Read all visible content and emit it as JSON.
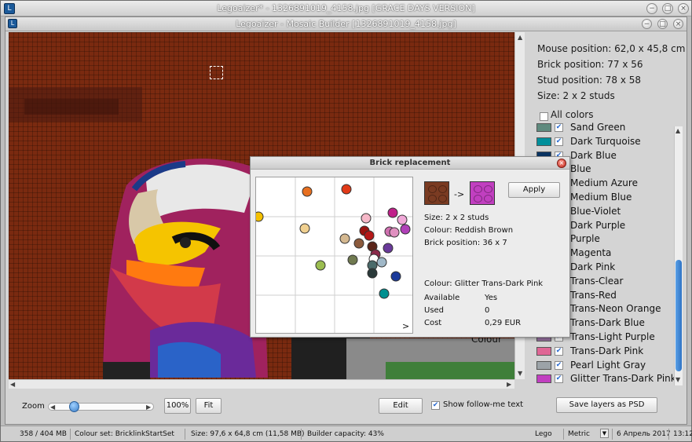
{
  "window": {
    "title": "Legoaizer* - 1326891019_4158.jpg       [GRACE DAYS VERSION]",
    "inner_title": "Legoaizer - Mosaic Builder [1326891019_4158.jpg]"
  },
  "info": {
    "mouse_position": "Mouse position: 62,0 x 45,8 cm",
    "brick_position": "Brick position: 77 x 56",
    "stud_position": "Stud position: 78 x 58",
    "size": "Size: 2 x 2 studs",
    "all_colors": "All colors"
  },
  "colors": [
    {
      "name": "Sand Green",
      "hex": "#5f8a7e"
    },
    {
      "name": "Dark Turquoise",
      "hex": "#008f9b"
    },
    {
      "name": "Dark Blue",
      "hex": "#0a3463"
    },
    {
      "name": "Blue",
      "hex": "#0055bf"
    },
    {
      "name": "Medium Azure",
      "hex": "#36aebf"
    },
    {
      "name": "Medium Blue",
      "hex": "#5a93db"
    },
    {
      "name": "Blue-Violet",
      "hex": "#4354a3"
    },
    {
      "name": "Dark Purple",
      "hex": "#3f3691"
    },
    {
      "name": "Purple",
      "hex": "#81007b"
    },
    {
      "name": "Magenta",
      "hex": "#923978"
    },
    {
      "name": "Dark Pink",
      "hex": "#c870a0"
    },
    {
      "name": "Trans-Clear",
      "hex": "#f0f0f0"
    },
    {
      "name": "Trans-Red",
      "hex": "#c91a09"
    },
    {
      "name": "Trans-Neon Orange",
      "hex": "#ff800d"
    },
    {
      "name": "Trans-Dark Blue",
      "hex": "#0020a0"
    },
    {
      "name": "Trans-Light Purple",
      "hex": "#96709f"
    },
    {
      "name": "Trans-Dark Pink",
      "hex": "#df6695"
    },
    {
      "name": "Pearl Light Gray",
      "hex": "#9ca3a8"
    },
    {
      "name": "Glitter Trans-Dark Pink",
      "hex": "#c13fc0"
    }
  ],
  "controls": {
    "zoom_label": "Zoom",
    "zoom_percent": "100%",
    "fit": "Fit",
    "edit": "Edit",
    "show_follow": "Show follow-me text",
    "save_layers": "Save layers as PSD",
    "zoom_level": 0.15
  },
  "status": {
    "memory": "358 / 404 MB",
    "colour_set": "Colour set: BricklinkStartSet",
    "size": "Size: 97,6 x 64,8 cm (11,58 MB)",
    "capacity": "Builder capacity: 43%",
    "lego": "Lego",
    "metric": "Metric",
    "date": "6 Апрель 2017",
    "time": "13:12"
  },
  "dialog": {
    "title": "Brick replacement",
    "apply": "Apply",
    "arrow": "->",
    "from_hex": "#7a3b22",
    "to_hex": "#c13fc0",
    "size": "Size: 2 x 2 studs",
    "colour": "Colour: Reddish Brown",
    "brick_position": "Brick position: 36 x 7",
    "target_colour": "Colour: Glitter Trans-Dark Pink",
    "available_label": "Available",
    "available_value": "Yes",
    "used_label": "Used",
    "used_value": "0",
    "cost_label": "Cost",
    "cost_value": "0,29 EUR",
    "more": ">"
  },
  "canvas_text": "Colour"
}
